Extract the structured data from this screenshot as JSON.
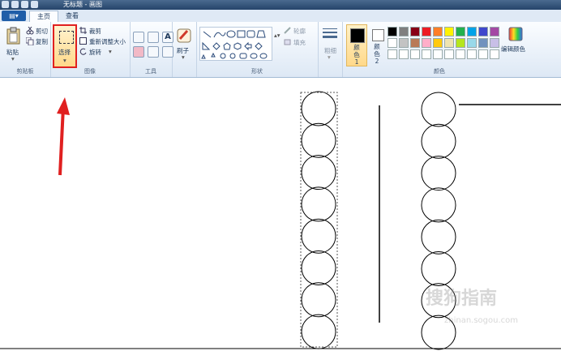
{
  "window": {
    "title": "无标题 - 画图"
  },
  "tabs": {
    "file": "▤▾",
    "home": "主页",
    "view": "查看"
  },
  "clipboard": {
    "paste": "粘贴",
    "cut": "剪切",
    "copy": "复制",
    "group": "剪贴板"
  },
  "image": {
    "select": "选择",
    "crop": "裁剪",
    "resize": "重新调整大小",
    "rotate": "旋转",
    "group": "图像"
  },
  "tools": {
    "group": "工具"
  },
  "brushes": {
    "label": "刷子"
  },
  "shapes": {
    "outline": "轮廓",
    "fill": "填充",
    "group": "形状"
  },
  "size": {
    "label": "粗细"
  },
  "colors": {
    "color1": "颜色 1",
    "color2": "颜色 2",
    "edit": "编辑颜色",
    "group": "颜色",
    "row1": [
      "#000000",
      "#7f7f7f",
      "#880015",
      "#ed1c24",
      "#ff7f27",
      "#fff200",
      "#22b14c",
      "#00a2e8",
      "#3f48cc",
      "#a349a4"
    ],
    "row2": [
      "#ffffff",
      "#c3c3c3",
      "#b97a57",
      "#ffaec9",
      "#ffc90e",
      "#efe4b0",
      "#b5e61d",
      "#99d9ea",
      "#7092be",
      "#c8bfe7"
    ],
    "row3": [
      "#ffffff",
      "#ffffff",
      "#ffffff",
      "#ffffff",
      "#ffffff",
      "#ffffff",
      "#ffffff",
      "#ffffff",
      "#ffffff",
      "#ffffff"
    ]
  },
  "annotation": {
    "arrow_color": "#e02020"
  },
  "watermark": {
    "text": "搜狗指南",
    "url": "zhinan.sogou.com"
  }
}
